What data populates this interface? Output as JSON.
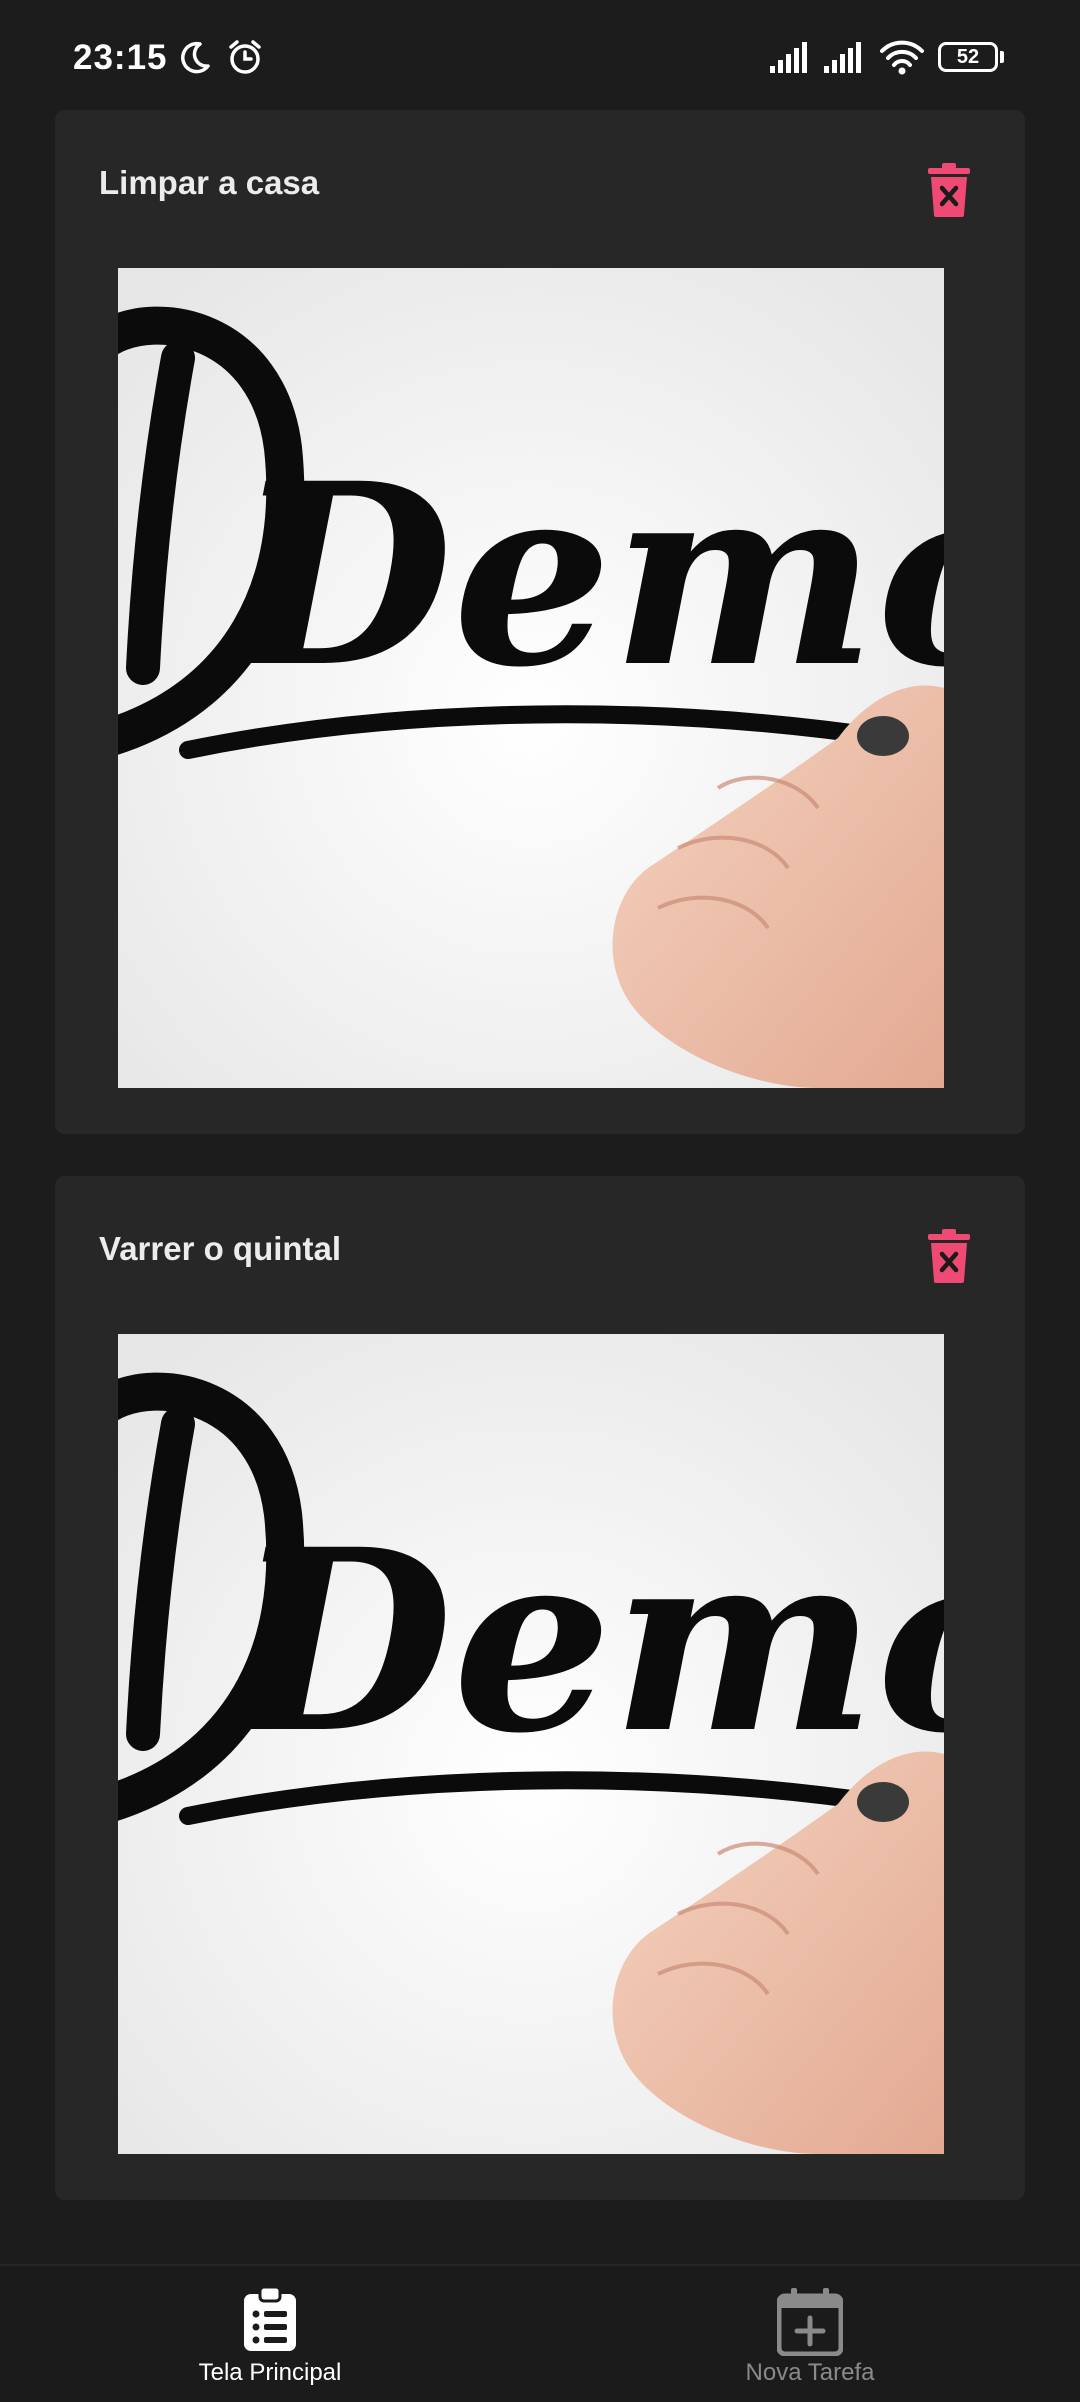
{
  "status_bar": {
    "time": "23:15",
    "battery": "52",
    "icons": [
      "moon-icon",
      "alarm-icon",
      "signal-icon",
      "signal-icon",
      "wifi-icon",
      "battery-icon"
    ]
  },
  "tasks": [
    {
      "title": "Limpar a casa",
      "delete_icon": "trash-icon",
      "image_text": "Demo"
    },
    {
      "title": "Varrer o quintal",
      "delete_icon": "trash-icon",
      "image_text": "Demo"
    }
  ],
  "colors": {
    "accent": "#ee4a73",
    "background": "#1c1c1d",
    "card": "#272727",
    "nav_active": "#ffffff",
    "nav_inactive": "#8a8a8a"
  },
  "bottom_nav": {
    "items": [
      {
        "label": "Tela Principal",
        "icon": "clipboard-list-icon",
        "active": true
      },
      {
        "label": "Nova Tarefa",
        "icon": "calendar-plus-icon",
        "active": false
      }
    ]
  }
}
